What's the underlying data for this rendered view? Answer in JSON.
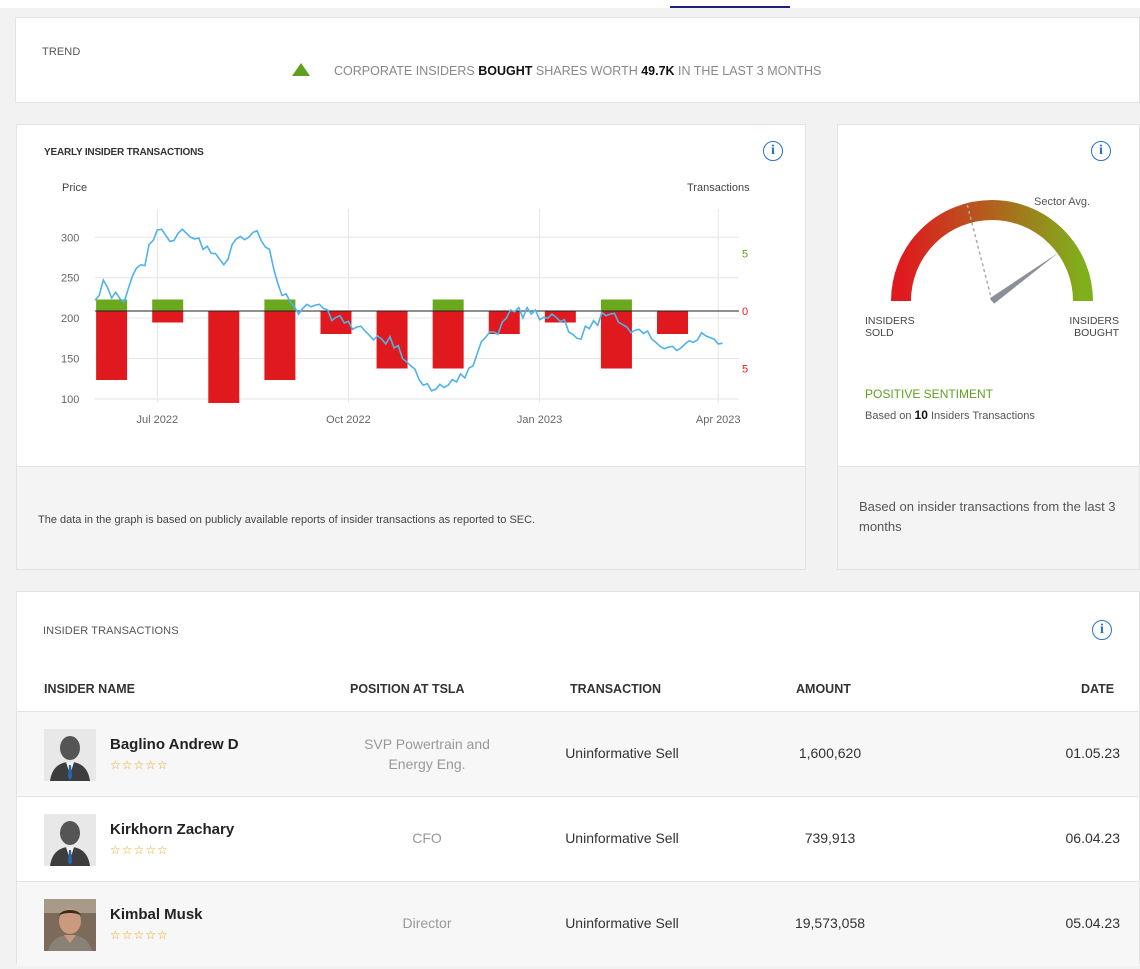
{
  "trend": {
    "label": "TREND",
    "text_pre": "CORPORATE INSIDERS ",
    "text_bold": "BOUGHT",
    "text_mid": " SHARES WORTH ",
    "text_value": "49.7K",
    "text_post": " IN THE LAST 3 MONTHS"
  },
  "chart_data": {
    "type": "line",
    "title": "YEARLY INSIDER TRANSACTIONS",
    "ylabel_left": "Price",
    "ylabel_right": "Transactions",
    "left_ticks": [
      "300",
      "250",
      "200",
      "150",
      "100"
    ],
    "right_ticks": [
      "5",
      "0",
      "5"
    ],
    "x_ticks": [
      "Jul 2022",
      "Oct 2022",
      "Jan 2023",
      "Apr 2023"
    ],
    "ylim_price": [
      95,
      335
    ],
    "ylim_transactions": [
      -8,
      8
    ],
    "price_series": {
      "color": "#4db3ea",
      "x_days": [
        0,
        2,
        4,
        6,
        8,
        10,
        12,
        14,
        16,
        18,
        20,
        22,
        24,
        26,
        28,
        30,
        32,
        34,
        36,
        38,
        40,
        42,
        44,
        46,
        48,
        50,
        52,
        54,
        56,
        58,
        60,
        62,
        64,
        66,
        68,
        70,
        72,
        74,
        76,
        78,
        80,
        82,
        84,
        86,
        88,
        90,
        92,
        94,
        96,
        98,
        100,
        102,
        104,
        106,
        108,
        110,
        112,
        114,
        116,
        118,
        120,
        122,
        124,
        126,
        128,
        130,
        132,
        134,
        136,
        138,
        140,
        142,
        144,
        146,
        148,
        150,
        152,
        154,
        156,
        158,
        160,
        162,
        164,
        166,
        168,
        170,
        172,
        174,
        176,
        178,
        180,
        182,
        184,
        186,
        188,
        190,
        192,
        194,
        196,
        198,
        200,
        202,
        204,
        206,
        208,
        210,
        212,
        214,
        216,
        218,
        220,
        222,
        224,
        226,
        228,
        230,
        232,
        234,
        236,
        238,
        240,
        242,
        244,
        246,
        248,
        250,
        252,
        254,
        256,
        258,
        260,
        262,
        264,
        266,
        268,
        270,
        272,
        274,
        276,
        278,
        280,
        282,
        284,
        286,
        288,
        290,
        292,
        294,
        296,
        298,
        300,
        302,
        304,
        306,
        308,
        310
      ],
      "values": [
        222,
        228,
        247,
        238,
        225,
        232,
        224,
        220,
        236,
        252,
        262,
        266,
        265,
        291,
        296,
        309,
        310,
        303,
        295,
        296,
        305,
        310,
        305,
        300,
        298,
        299,
        285,
        289,
        280,
        280,
        273,
        266,
        273,
        291,
        298,
        301,
        297,
        300,
        306,
        308,
        296,
        288,
        285,
        261,
        243,
        228,
        230,
        220,
        214,
        205,
        212,
        217,
        214,
        216,
        217,
        212,
        210,
        197,
        201,
        203,
        194,
        196,
        186,
        189,
        190,
        184,
        179,
        173,
        178,
        174,
        168,
        177,
        163,
        166,
        150,
        146,
        141,
        137,
        124,
        117,
        119,
        110,
        112,
        118,
        114,
        117,
        124,
        121,
        131,
        126,
        138,
        141,
        156,
        171,
        176,
        183,
        183,
        180,
        195,
        200,
        210,
        208,
        213,
        200,
        213,
        205,
        210,
        198,
        201,
        200,
        205,
        201,
        196,
        198,
        183,
        180,
        175,
        174,
        190,
        187,
        197,
        191,
        207,
        203,
        205,
        206,
        195,
        192,
        189,
        182,
        185,
        186,
        181,
        184,
        174,
        170,
        165,
        162,
        164,
        165,
        160,
        163,
        168,
        172,
        170,
        173,
        182,
        178,
        176,
        174,
        168,
        169
      ],
      "comment": "approximate daily closes"
    },
    "transaction_bars": [
      {
        "x_day": 8,
        "buys": 1,
        "sells": -6
      },
      {
        "x_day": 35,
        "buys": 1,
        "sells": -1
      },
      {
        "x_day": 62,
        "buys": 0,
        "sells": -8
      },
      {
        "x_day": 89,
        "buys": 1,
        "sells": -6
      },
      {
        "x_day": 116,
        "buys": 0,
        "sells": -2
      },
      {
        "x_day": 143,
        "buys": 0,
        "sells": -5
      },
      {
        "x_day": 170,
        "buys": 1,
        "sells": -5
      },
      {
        "x_day": 197,
        "buys": 0,
        "sells": -2
      },
      {
        "x_day": 224,
        "buys": 0,
        "sells": -1
      },
      {
        "x_day": 251,
        "buys": 1,
        "sells": -5
      },
      {
        "x_day": 278,
        "buys": 0,
        "sells": -2
      }
    ],
    "colors": {
      "buy": "#6aa81d",
      "sell": "#e0191f",
      "zero_line": "#222",
      "right_axis_pos": "#5fa11f",
      "right_axis_neg": "#e0191f"
    },
    "grid": true
  },
  "chart_footer": "The data in the graph is based on publicly available reports of insider transactions as reported to SEC.",
  "sentiment": {
    "sector_avg_label": "Sector Avg.",
    "sold_label_1": "INSIDERS",
    "sold_label_2": "SOLD",
    "bought_label_1": "INSIDERS",
    "bought_label_2": "BOUGHT",
    "headline": "POSITIVE SENTIMENT",
    "based_pre": "Based on ",
    "based_count": "10",
    "based_post": " Insiders Transactions",
    "needle_fraction": 0.8,
    "sector_avg_fraction": 0.42,
    "footer": "Based on insider transactions from the last 3 months"
  },
  "table": {
    "label": "INSIDER TRANSACTIONS",
    "headers": {
      "name": "INSIDER NAME",
      "position": "POSITION AT TSLA",
      "transaction": "TRANSACTION",
      "amount": "AMOUNT",
      "date": "DATE"
    },
    "rows": [
      {
        "name": "Baglino Andrew D",
        "stars": "☆☆☆☆☆",
        "position_1": "SVP Powertrain and",
        "position_2": "Energy Eng.",
        "transaction": "Uninformative Sell",
        "amount": "1,600,620",
        "date": "01.05.23",
        "avatar": "silhouette"
      },
      {
        "name": "Kirkhorn Zachary",
        "stars": "☆☆☆☆☆",
        "position_1": "CFO",
        "position_2": "",
        "transaction": "Uninformative Sell",
        "amount": "739,913",
        "date": "06.04.23",
        "avatar": "silhouette"
      },
      {
        "name": "Kimbal Musk",
        "stars": "☆☆☆☆☆",
        "position_1": "Director",
        "position_2": "",
        "transaction": "Uninformative Sell",
        "amount": "19,573,058",
        "date": "05.04.23",
        "avatar": "photo"
      }
    ]
  },
  "icons": {
    "info": "i"
  }
}
